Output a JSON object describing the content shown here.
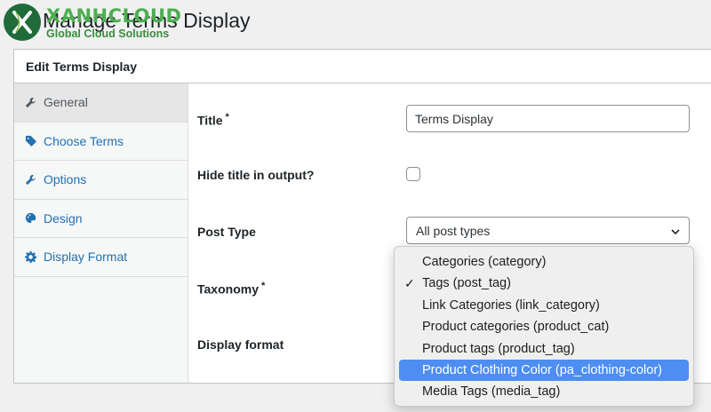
{
  "header": {
    "title": "Manage Terms Display",
    "logo_name": "XANHCLOUD",
    "logo_tagline": "Global Cloud Solutions"
  },
  "panel": {
    "title": "Edit Terms Display"
  },
  "sidebar": {
    "items": [
      {
        "label": "General",
        "icon": "wrench-icon",
        "active": true
      },
      {
        "label": "Choose Terms",
        "icon": "tag-icon",
        "active": false
      },
      {
        "label": "Options",
        "icon": "wrench-icon",
        "active": false
      },
      {
        "label": "Design",
        "icon": "palette-icon",
        "active": false
      },
      {
        "label": "Display Format",
        "icon": "gear-icon",
        "active": false
      }
    ]
  },
  "form": {
    "title_label": "Title",
    "title_required": "*",
    "title_value": "Terms Display",
    "hide_title_label": "Hide title in output?",
    "hide_title_checked": false,
    "post_type_label": "Post Type",
    "post_type_value": "All post types",
    "taxonomy_label": "Taxonomy",
    "taxonomy_required": "*",
    "display_format_label": "Display format"
  },
  "taxonomy_dropdown": {
    "options": [
      {
        "label": "Categories (category)",
        "selected": false,
        "highlighted": false
      },
      {
        "label": "Tags (post_tag)",
        "selected": true,
        "highlighted": false
      },
      {
        "label": "Link Categories (link_category)",
        "selected": false,
        "highlighted": false
      },
      {
        "label": "Product categories (product_cat)",
        "selected": false,
        "highlighted": false
      },
      {
        "label": "Product tags (product_tag)",
        "selected": false,
        "highlighted": false
      },
      {
        "label": "Product Clothing Color (pa_clothing-color)",
        "selected": false,
        "highlighted": true
      },
      {
        "label": "Media Tags (media_tag)",
        "selected": false,
        "highlighted": false
      }
    ],
    "check_glyph": "✓"
  },
  "colors": {
    "accent": "#2271b1",
    "highlight": "#4e8ef2",
    "logo_green": "#4caf50"
  }
}
